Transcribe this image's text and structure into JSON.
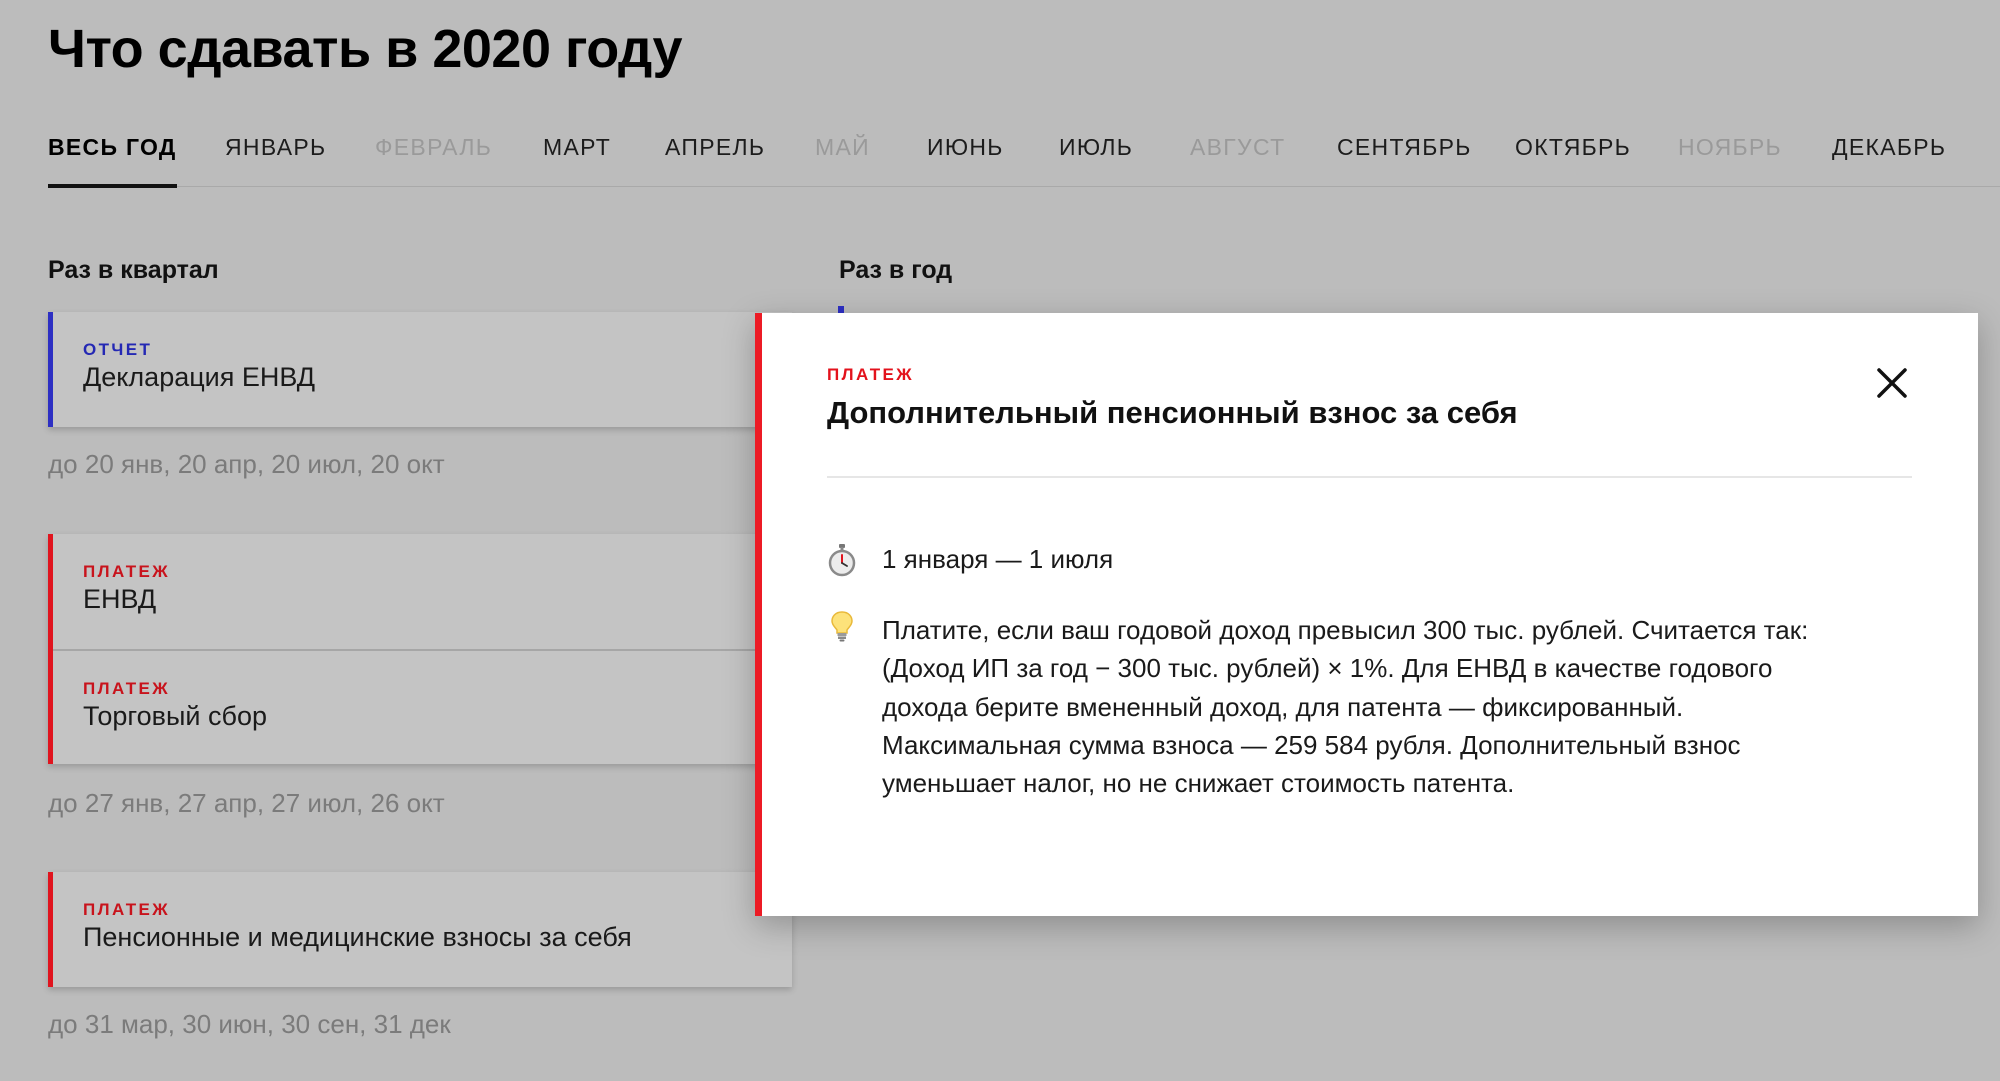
{
  "page": {
    "title": "Что сдавать в 2020 году"
  },
  "tabs": [
    {
      "label": "Весь год",
      "state": "active"
    },
    {
      "label": "Январь",
      "state": "normal"
    },
    {
      "label": "Февраль",
      "state": "disabled"
    },
    {
      "label": "Март",
      "state": "normal"
    },
    {
      "label": "Апрель",
      "state": "normal"
    },
    {
      "label": "Май",
      "state": "disabled"
    },
    {
      "label": "Июнь",
      "state": "normal"
    },
    {
      "label": "Июль",
      "state": "normal"
    },
    {
      "label": "Август",
      "state": "disabled"
    },
    {
      "label": "Сентябрь",
      "state": "normal"
    },
    {
      "label": "Октябрь",
      "state": "normal"
    },
    {
      "label": "Ноябрь",
      "state": "disabled"
    },
    {
      "label": "Декабрь",
      "state": "normal"
    }
  ],
  "quarterly": {
    "heading": "Раз в квартал",
    "groups": [
      {
        "items": [
          {
            "kind": "ОТЧЕТ",
            "name": "Декларация ЕНВД",
            "color": "#2d2fc3"
          }
        ],
        "deadline": "до 20 янв, 20 апр, 20 июл, 20 окт"
      },
      {
        "items": [
          {
            "kind": "ПЛАТЕЖ",
            "name": "ЕНВД",
            "color": "#e0141e"
          },
          {
            "kind": "ПЛАТЕЖ",
            "name": "Торговый сбор",
            "color": "#e0141e"
          }
        ],
        "deadline": "до 27 янв, 27 апр, 27 июл, 26 окт"
      },
      {
        "items": [
          {
            "kind": "ПЛАТЕЖ",
            "name": "Пенсионные и медицинские взносы за себя",
            "color": "#e0141e"
          }
        ],
        "deadline": "до 31 мар, 30 июн, 30 сен, 31 дек"
      }
    ]
  },
  "yearly": {
    "heading": "Раз в год"
  },
  "modal": {
    "kind": "ПЛАТЕЖ",
    "title": "Дополнительный пенсионный взнос за себя",
    "date_icon": "stopwatch-icon",
    "date": "1 января — 1 июля",
    "info_icon": "lightbulb-icon",
    "description_lines": [
      "Платите, если ваш годовой доход превысил 300 тыс. рублей. Считается так:",
      "(Доход ИП за год − 300 тыс. рублей) × 1%. Для ЕНВД в качестве годового",
      "дохода берите вмененный доход, для патента — фиксированный.",
      "Максимальная сумма взноса — 259 584 рубля. Дополнительный взнос",
      "уменьшает налог, но не снижает стоимость патента."
    ],
    "accent_color": "#ec1b25"
  }
}
